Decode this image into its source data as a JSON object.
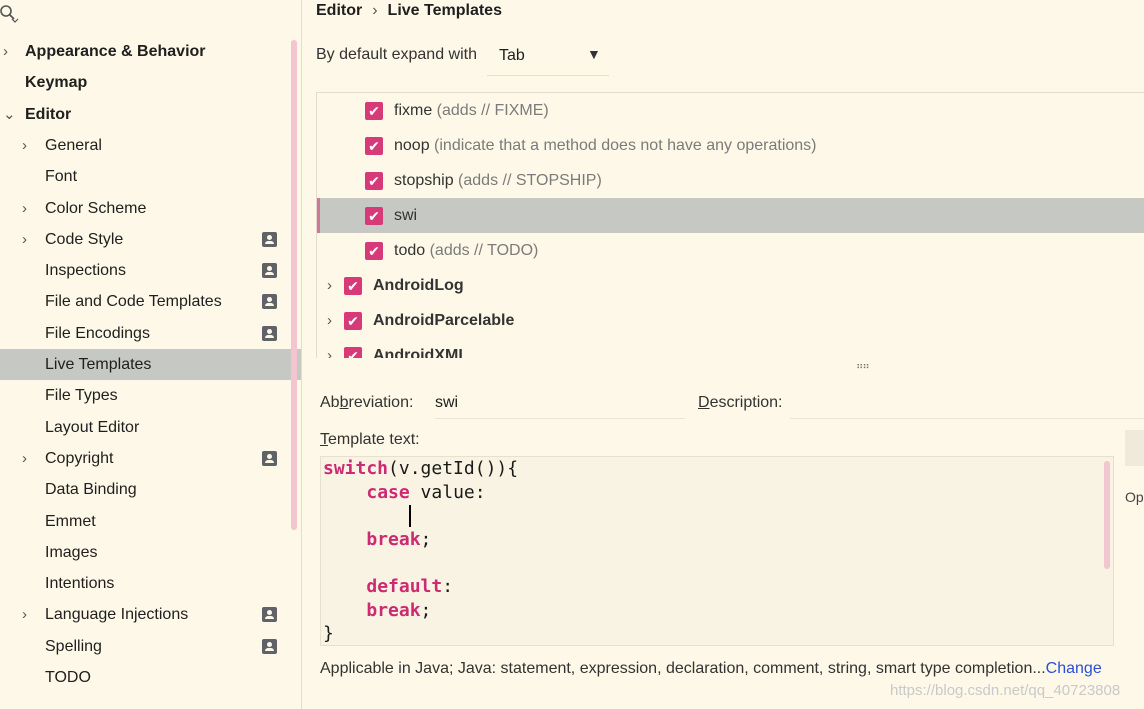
{
  "sidebar": {
    "search_icon": "search-icon",
    "items": [
      {
        "label": "Appearance & Behavior",
        "level": 0,
        "arrow": "›",
        "profile": false,
        "selected": false
      },
      {
        "label": "Keymap",
        "level": 0,
        "arrow": "",
        "profile": false,
        "selected": false
      },
      {
        "label": "Editor",
        "level": 0,
        "arrow": "⌄",
        "profile": false,
        "selected": false
      },
      {
        "label": "General",
        "level": 1,
        "arrow": "›",
        "profile": false,
        "selected": false
      },
      {
        "label": "Font",
        "level": 1,
        "arrow": "",
        "profile": false,
        "selected": false
      },
      {
        "label": "Color Scheme",
        "level": 1,
        "arrow": "›",
        "profile": false,
        "selected": false
      },
      {
        "label": "Code Style",
        "level": 1,
        "arrow": "›",
        "profile": true,
        "selected": false
      },
      {
        "label": "Inspections",
        "level": 1,
        "arrow": "",
        "profile": true,
        "selected": false
      },
      {
        "label": "File and Code Templates",
        "level": 1,
        "arrow": "",
        "profile": true,
        "selected": false
      },
      {
        "label": "File Encodings",
        "level": 1,
        "arrow": "",
        "profile": true,
        "selected": false
      },
      {
        "label": "Live Templates",
        "level": 1,
        "arrow": "",
        "profile": false,
        "selected": true
      },
      {
        "label": "File Types",
        "level": 1,
        "arrow": "",
        "profile": false,
        "selected": false
      },
      {
        "label": "Layout Editor",
        "level": 1,
        "arrow": "",
        "profile": false,
        "selected": false
      },
      {
        "label": "Copyright",
        "level": 1,
        "arrow": "›",
        "profile": true,
        "selected": false
      },
      {
        "label": "Data Binding",
        "level": 1,
        "arrow": "",
        "profile": false,
        "selected": false
      },
      {
        "label": "Emmet",
        "level": 1,
        "arrow": "",
        "profile": false,
        "selected": false
      },
      {
        "label": "Images",
        "level": 1,
        "arrow": "",
        "profile": false,
        "selected": false
      },
      {
        "label": "Intentions",
        "level": 1,
        "arrow": "",
        "profile": false,
        "selected": false
      },
      {
        "label": "Language Injections",
        "level": 1,
        "arrow": "›",
        "profile": true,
        "selected": false
      },
      {
        "label": "Spelling",
        "level": 1,
        "arrow": "",
        "profile": true,
        "selected": false
      },
      {
        "label": "TODO",
        "level": 1,
        "arrow": "",
        "profile": false,
        "selected": false
      }
    ]
  },
  "breadcrumb": {
    "parent": "Editor",
    "separator": "›",
    "current": "Live Templates"
  },
  "expand": {
    "label": "By default expand with",
    "value": "Tab",
    "caret": "▼"
  },
  "templates": [
    {
      "kind": "item",
      "name": "fixme",
      "desc": " (adds // FIXME)",
      "checked": true,
      "selected": false
    },
    {
      "kind": "item",
      "name": "noop",
      "desc": " (indicate that a method does not have any operations)",
      "checked": true,
      "selected": false
    },
    {
      "kind": "item",
      "name": "stopship",
      "desc": " (adds // STOPSHIP)",
      "checked": true,
      "selected": false
    },
    {
      "kind": "item",
      "name": "swi",
      "desc": "",
      "checked": true,
      "selected": true
    },
    {
      "kind": "item",
      "name": "todo",
      "desc": " (adds // TODO)",
      "checked": true,
      "selected": false
    },
    {
      "kind": "group",
      "name": "AndroidLog",
      "desc": "",
      "checked": true,
      "selected": false
    },
    {
      "kind": "group",
      "name": "AndroidParcelable",
      "desc": "",
      "checked": true,
      "selected": false
    },
    {
      "kind": "group",
      "name": "AndroidXML",
      "desc": "",
      "checked": true,
      "selected": false
    }
  ],
  "splitter_glyph": "⠶⠶",
  "editor": {
    "abbreviation_label": {
      "pre": "Ab",
      "mn": "b",
      "post": "reviation:"
    },
    "abbreviation_value": "swi",
    "description_label": {
      "pre": "",
      "mn": "D",
      "post": "escription:"
    },
    "template_text_label": {
      "pre": "",
      "mn": "T",
      "post": "emplate text:"
    },
    "code_lines": [
      [
        {
          "t": "switch",
          "k": true
        },
        {
          "t": "(v.getId()){",
          "k": false
        }
      ],
      [
        {
          "t": "    ",
          "k": false
        },
        {
          "t": "case",
          "k": true
        },
        {
          "t": " value:",
          "k": false
        }
      ],
      [
        {
          "t": "",
          "k": false
        }
      ],
      [
        {
          "t": "    ",
          "k": false
        },
        {
          "t": "break",
          "k": true
        },
        {
          "t": ";",
          "k": false
        }
      ],
      [
        {
          "t": "",
          "k": false
        }
      ],
      [
        {
          "t": "    ",
          "k": false
        },
        {
          "t": "default",
          "k": true
        },
        {
          "t": ":",
          "k": false
        }
      ],
      [
        {
          "t": "    ",
          "k": false
        },
        {
          "t": "break",
          "k": true
        },
        {
          "t": ";",
          "k": false
        }
      ],
      [
        {
          "t": "}",
          "k": false
        }
      ]
    ],
    "options_label": "Op",
    "applicable_text": "Applicable in Java; Java: statement, expression, declaration, comment, string, smart type completion...",
    "change_link": "Change"
  },
  "watermark": "https://blog.csdn.net/qq_40723808",
  "colors": {
    "accent": "#d73a78",
    "keyword": "#cc2a73",
    "selection": "#c6c8c3",
    "link": "#2a4fd6",
    "background": "#fdf8e7"
  }
}
